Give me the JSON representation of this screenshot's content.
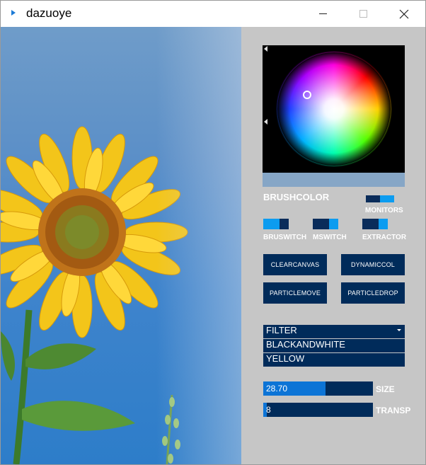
{
  "window": {
    "title": "dazuoye",
    "minimize_icon": "minimize-icon",
    "maximize_icon": "maximize-icon",
    "close_icon": "close-icon",
    "close_glyph": "✕"
  },
  "canvas": {
    "content": "sunflower photo against blue sky"
  },
  "controls": {
    "brushcolor_label": "BRUSHCOLOR",
    "monitors_label": "MONITORS",
    "monitors_state": 0.5,
    "bruswitch_label": "BRUSWITCH",
    "bruswitch_state": 0.63,
    "mswitch_label": "MSWITCH",
    "mswitch_state": 0.37,
    "extractor_label": "EXTRACTOR",
    "extractor_state": 0.37,
    "buttons": {
      "clearcanvas": "CLEARCANVAS",
      "dynamiccol": "DYNAMICCOL",
      "particlemove": "PARTICLEMOVE",
      "particledrop": "PARTICLEDROP"
    },
    "filter": {
      "label": "FILTER",
      "options": [
        "BLACKANDWHITE",
        "YELLOW"
      ]
    },
    "size": {
      "label": "SIZE",
      "value": "28.70",
      "fraction": 0.57
    },
    "transp": {
      "label": "TRANSP",
      "value": "8",
      "fraction": 0.03
    },
    "preview_color": "#86a6c6",
    "accent": "#0c9cf0",
    "dark": "#002b5a"
  }
}
